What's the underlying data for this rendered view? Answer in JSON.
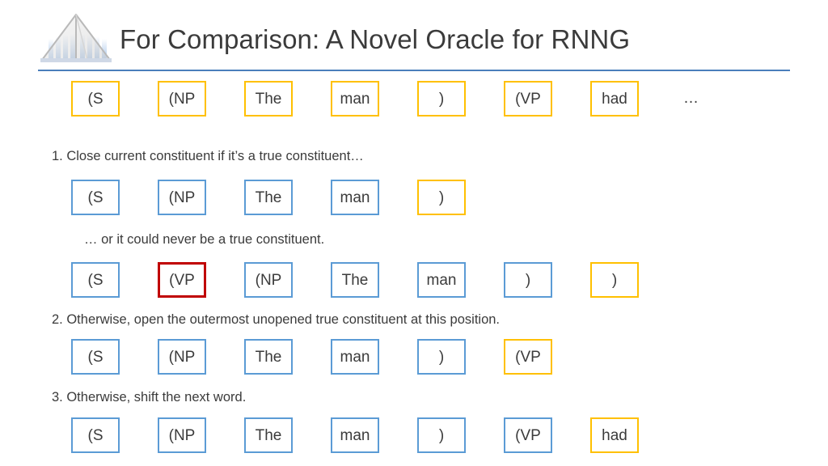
{
  "header": {
    "title": "For Comparison: A Novel Oracle for RNNG",
    "logo_name": "institution-building-logo",
    "rule_color": "#4a7ebb"
  },
  "colors": {
    "yellow": "#ffc000",
    "blue": "#5b9bd5",
    "red": "#c00000",
    "text": "#3b3b3b"
  },
  "rows": {
    "initial": {
      "tokens": [
        {
          "label": "(S",
          "style": "yellow"
        },
        {
          "label": "(NP",
          "style": "yellow"
        },
        {
          "label": "The",
          "style": "yellow"
        },
        {
          "label": "man",
          "style": "yellow"
        },
        {
          "label": ")",
          "style": "yellow"
        },
        {
          "label": "(VP",
          "style": "yellow"
        },
        {
          "label": "had",
          "style": "yellow"
        }
      ],
      "trailing": "…"
    },
    "rule_1a": {
      "tokens": [
        {
          "label": "(S",
          "style": "blue"
        },
        {
          "label": "(NP",
          "style": "blue"
        },
        {
          "label": "The",
          "style": "blue"
        },
        {
          "label": "man",
          "style": "blue"
        },
        {
          "label": ")",
          "style": "yellow"
        }
      ]
    },
    "rule_1b": {
      "tokens": [
        {
          "label": "(S",
          "style": "blue"
        },
        {
          "label": "(VP",
          "style": "red"
        },
        {
          "label": "(NP",
          "style": "blue"
        },
        {
          "label": "The",
          "style": "blue"
        },
        {
          "label": "man",
          "style": "blue"
        },
        {
          "label": ")",
          "style": "blue"
        },
        {
          "label": ")",
          "style": "yellow"
        }
      ]
    },
    "rule_2": {
      "tokens": [
        {
          "label": "(S",
          "style": "blue"
        },
        {
          "label": "(NP",
          "style": "blue"
        },
        {
          "label": "The",
          "style": "blue"
        },
        {
          "label": "man",
          "style": "blue"
        },
        {
          "label": ")",
          "style": "blue"
        },
        {
          "label": "(VP",
          "style": "yellow"
        }
      ]
    },
    "rule_3": {
      "tokens": [
        {
          "label": "(S",
          "style": "blue"
        },
        {
          "label": "(NP",
          "style": "blue"
        },
        {
          "label": "The",
          "style": "blue"
        },
        {
          "label": "man",
          "style": "blue"
        },
        {
          "label": ")",
          "style": "blue"
        },
        {
          "label": "(VP",
          "style": "blue"
        },
        {
          "label": "had",
          "style": "yellow"
        }
      ]
    }
  },
  "texts": {
    "rule_1": "1. Close current constituent if it’s a true constituent…",
    "rule_1b": "… or it could never be a true constituent.",
    "rule_2": "2. Otherwise, open the outermost unopened true constituent at this position.",
    "rule_3": "3. Otherwise, shift the next word."
  }
}
